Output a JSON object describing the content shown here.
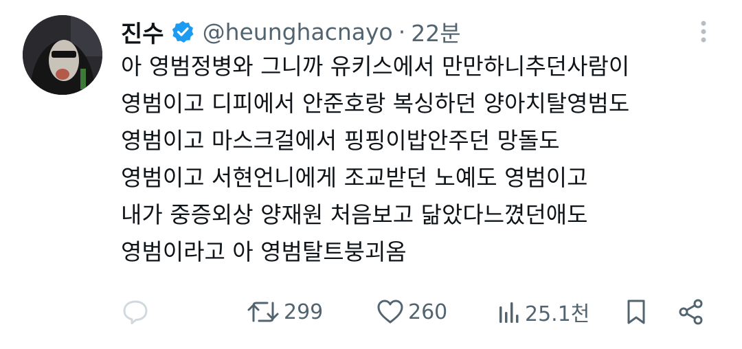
{
  "author": {
    "display_name": "진수",
    "handle": "@heunghacnayo",
    "separator": "·",
    "time": "22분",
    "verified": true,
    "verified_color": "#1d9bf0"
  },
  "tweet": {
    "lines": [
      "아 영범정병와 그니까 유키스에서 만만하니추던사람이",
      "영범이고 디피에서 안준호랑 복싱하던 양아치탈영범도",
      "영범이고 마스크걸에서 핑핑이밥안주던 망돌도",
      "영범이고 서현언니에게 조교받던 노예도 영범이고",
      "내가 중증외상 양재원 처음보고 닮았다느꼈던애도",
      "영범이라고 아 영범탈트붕괴옴"
    ]
  },
  "actions": {
    "reply": {
      "icon": "reply-icon",
      "count": ""
    },
    "retweet": {
      "icon": "retweet-icon",
      "count": "299"
    },
    "like": {
      "icon": "heart-icon",
      "count": "260"
    },
    "views": {
      "icon": "views-icon",
      "count": "25.1천"
    },
    "bookmark": {
      "icon": "bookmark-icon"
    },
    "share": {
      "icon": "share-icon"
    }
  },
  "colors": {
    "text": "#0f1419",
    "secondary": "#536471",
    "reply_faded": "#cfd9de"
  }
}
